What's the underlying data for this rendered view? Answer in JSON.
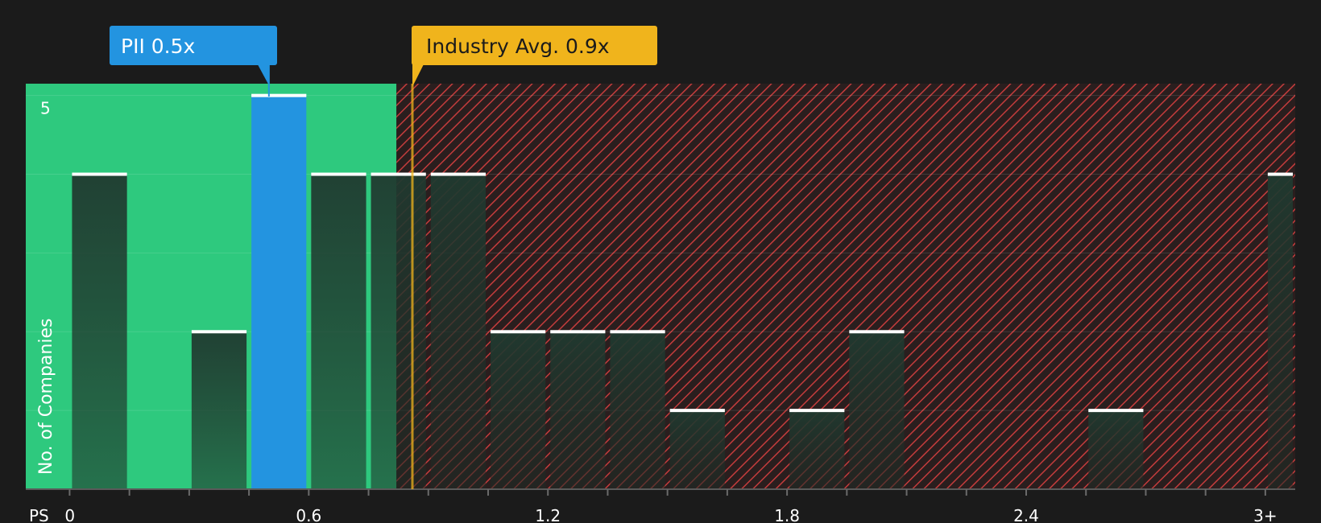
{
  "chart_data": {
    "type": "bar",
    "xlabel": "PS",
    "ylabel": "No. of Companies",
    "x_tick_labels": [
      "0",
      "0.6",
      "1.2",
      "1.8",
      "2.4",
      "3+"
    ],
    "x_tick_values": [
      0,
      0.6,
      1.2,
      1.8,
      2.4,
      3.0
    ],
    "xlim": [
      -0.11,
      3.075
    ],
    "y_tick_labels": [
      "5"
    ],
    "y_tick_values": [
      5
    ],
    "ylim": [
      0,
      5.15
    ],
    "bin_width": 0.15,
    "bins": [
      {
        "start": 0.0,
        "end": 0.15,
        "value": 4
      },
      {
        "start": 0.15,
        "end": 0.3,
        "value": 0
      },
      {
        "start": 0.3,
        "end": 0.45,
        "value": 2
      },
      {
        "start": 0.45,
        "end": 0.6,
        "value": 5,
        "highlight": true
      },
      {
        "start": 0.6,
        "end": 0.75,
        "value": 4
      },
      {
        "start": 0.75,
        "end": 0.9,
        "value": 4
      },
      {
        "start": 0.9,
        "end": 1.05,
        "value": 4
      },
      {
        "start": 1.05,
        "end": 1.2,
        "value": 2
      },
      {
        "start": 1.2,
        "end": 1.35,
        "value": 2
      },
      {
        "start": 1.35,
        "end": 1.5,
        "value": 2
      },
      {
        "start": 1.5,
        "end": 1.65,
        "value": 1
      },
      {
        "start": 1.65,
        "end": 1.8,
        "value": 0
      },
      {
        "start": 1.8,
        "end": 1.95,
        "value": 1
      },
      {
        "start": 1.95,
        "end": 2.1,
        "value": 2
      },
      {
        "start": 2.1,
        "end": 2.25,
        "value": 0
      },
      {
        "start": 2.25,
        "end": 2.4,
        "value": 0
      },
      {
        "start": 2.4,
        "end": 2.55,
        "value": 0
      },
      {
        "start": 2.55,
        "end": 2.7,
        "value": 1
      },
      {
        "start": 2.7,
        "end": 2.85,
        "value": 0
      },
      {
        "start": 2.85,
        "end": 3.0,
        "value": 0
      },
      {
        "start": 3.0,
        "end": 3.075,
        "value": 4
      }
    ],
    "fair_value_region_end": 0.82,
    "company": {
      "label": "PII 0.5x",
      "value": 0.5
    },
    "industry": {
      "label": "Industry Avg. 0.9x",
      "value": 0.86
    },
    "colors": {
      "background": "#1b1b1b",
      "undervalued": "#2ec97e",
      "overvalued_hatch": "#c43c3c",
      "company": "#2394e0",
      "industry": "#f0b41c",
      "bar_fill": "#1e2a24",
      "bar_cap": "#ffffff"
    },
    "grid": true
  }
}
